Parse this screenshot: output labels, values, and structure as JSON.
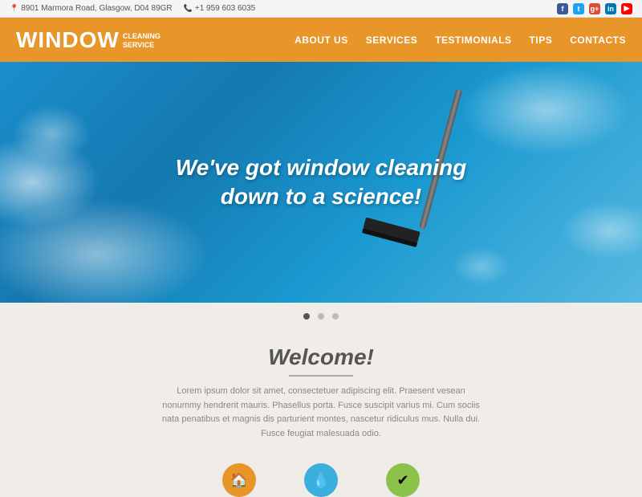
{
  "topbar": {
    "address": "8901 Marmora Road, Glasgow, D04 89GR",
    "phone": "+1 959 603 6035"
  },
  "logo": {
    "brand": "WINDOW",
    "sub_line1": "CLEANING",
    "sub_line2": "SERVICE"
  },
  "nav": {
    "items": [
      {
        "label": "ABOUT US",
        "id": "about-us"
      },
      {
        "label": "SERVICES",
        "id": "services"
      },
      {
        "label": "TESTIMONIALS",
        "id": "testimonials"
      },
      {
        "label": "TIPS",
        "id": "tips"
      },
      {
        "label": "CONTACTS",
        "id": "contacts"
      }
    ]
  },
  "hero": {
    "headline_line1": "We've got window cleaning",
    "headline_line2": "down to a science!"
  },
  "dots": {
    "count": 3,
    "active": 0
  },
  "welcome": {
    "title": "Welcome!",
    "body": "Lorem ipsum dolor sit amet, consectetuer adipiscing elit. Praesent vesean nonummy hendrerit mauris. Phasellus porta. Fusce suscipit varius mi. Cum sociis nata penatibus et magnis dis parturient montes, nascetur ridiculus mus. Nulla dui. Fusce feugiat malesuada odio."
  },
  "bottom_icons": [
    {
      "icon": "🏠",
      "color": "orange"
    },
    {
      "icon": "💧",
      "color": "blue"
    },
    {
      "icon": "✔",
      "color": "green"
    }
  ],
  "social": {
    "icons": [
      "f",
      "t",
      "g",
      "in",
      "▶"
    ]
  }
}
